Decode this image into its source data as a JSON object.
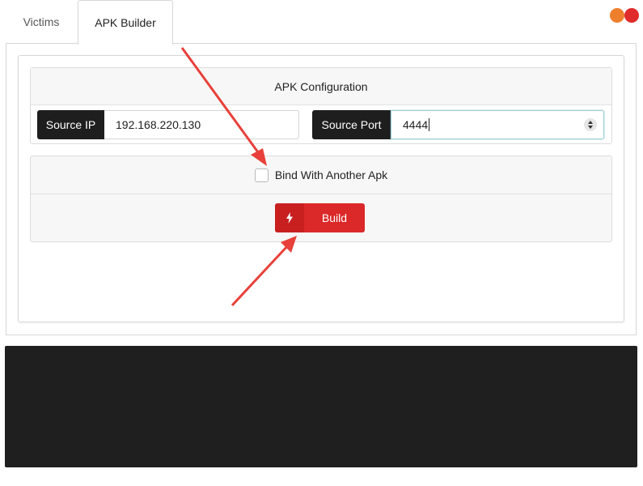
{
  "tabs": [
    {
      "label": "Victims"
    },
    {
      "label": "APK Builder"
    }
  ],
  "window_controls": {
    "minimize_color": "#ee7f2d",
    "close_color": "#e02b2b"
  },
  "config": {
    "title": "APK Configuration",
    "source_ip": {
      "label": "Source IP",
      "value": "192.168.220.130"
    },
    "source_port": {
      "label": "Source Port",
      "value": "4444"
    }
  },
  "bind": {
    "label": "Bind With Another Apk",
    "checked": false
  },
  "build": {
    "label": "Build",
    "icon": "bolt-icon",
    "color": "#db2828"
  },
  "annotation": {
    "arrow_color": "#e8403a"
  }
}
